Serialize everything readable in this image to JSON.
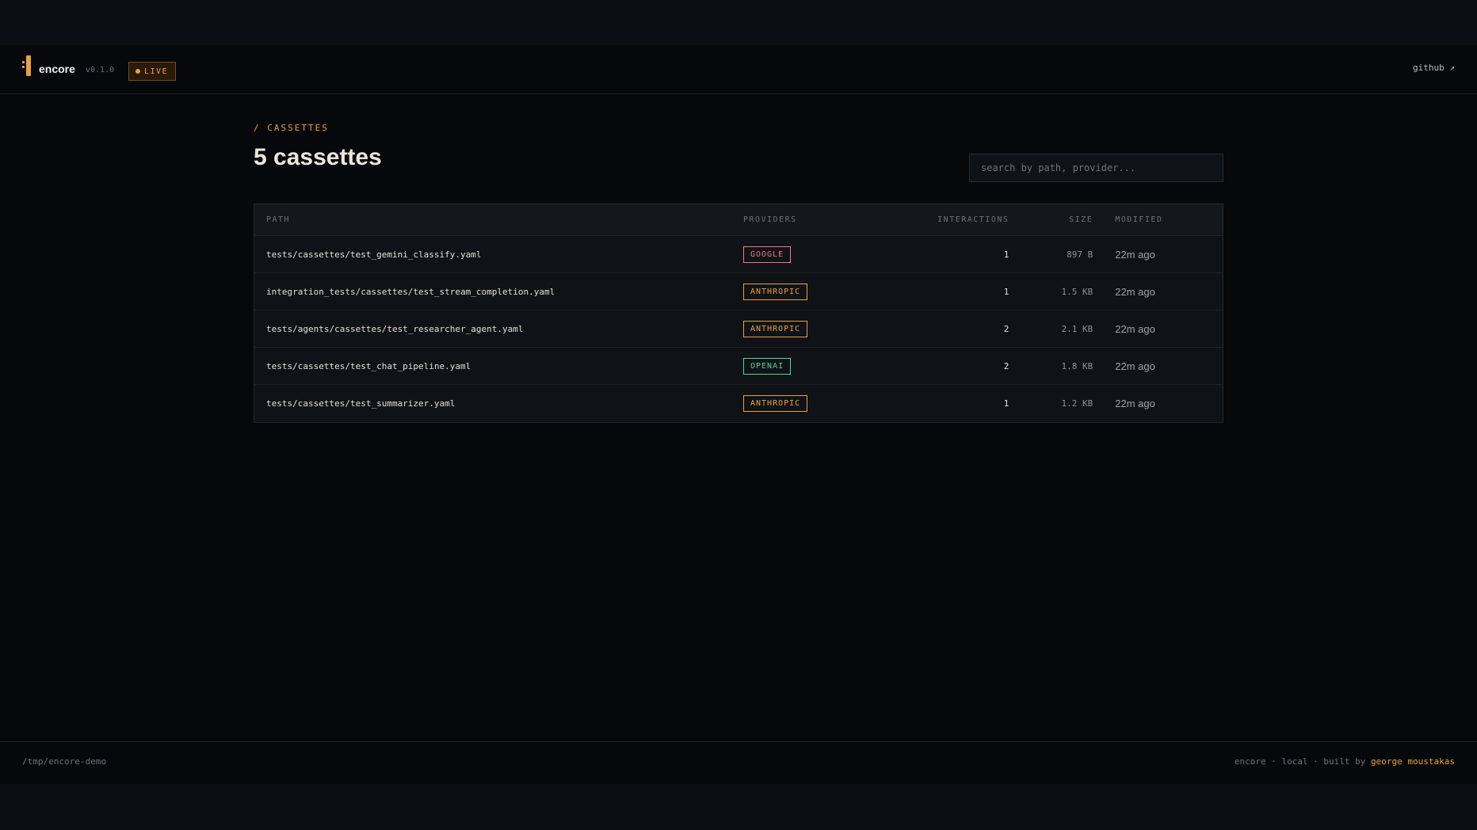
{
  "header": {
    "brand": "encore",
    "version": "v0.1.0",
    "live_label": "LIVE",
    "github_label": "github ↗"
  },
  "main": {
    "breadcrumb": "/ CASSETTES",
    "title": "5 cassettes",
    "search_placeholder": "search by path, provider..."
  },
  "table": {
    "headers": {
      "path": "PATH",
      "providers": "PROVIDERS",
      "interactions": "INTERACTIONS",
      "size": "SIZE",
      "modified": "MODIFIED"
    },
    "rows": [
      {
        "path": "tests/cassettes/test_gemini_classify.yaml",
        "provider": "GOOGLE",
        "provider_color": "#f07b86",
        "interactions": "1",
        "size": "897 B",
        "modified": "22m ago"
      },
      {
        "path": "integration_tests/cassettes/test_stream_completion.yaml",
        "provider": "ANTHROPIC",
        "provider_color": "#e8a23b",
        "interactions": "1",
        "size": "1.5 KB",
        "modified": "22m ago"
      },
      {
        "path": "tests/agents/cassettes/test_researcher_agent.yaml",
        "provider": "ANTHROPIC",
        "provider_color": "#e8a23b",
        "interactions": "2",
        "size": "2.1 KB",
        "modified": "22m ago"
      },
      {
        "path": "tests/cassettes/test_chat_pipeline.yaml",
        "provider": "OPENAI",
        "provider_color": "#5fcf95",
        "interactions": "2",
        "size": "1.8 KB",
        "modified": "22m ago"
      },
      {
        "path": "tests/cassettes/test_summarizer.yaml",
        "provider": "ANTHROPIC",
        "provider_color": "#e8a23b",
        "interactions": "1",
        "size": "1.2 KB",
        "modified": "22m ago"
      }
    ]
  },
  "footer": {
    "path": "/tmp/encore-demo",
    "meta": "encore · local · built by ",
    "author": "george moustakas"
  },
  "colors": {
    "accent": "#e8a23b",
    "background": "#07080b"
  }
}
